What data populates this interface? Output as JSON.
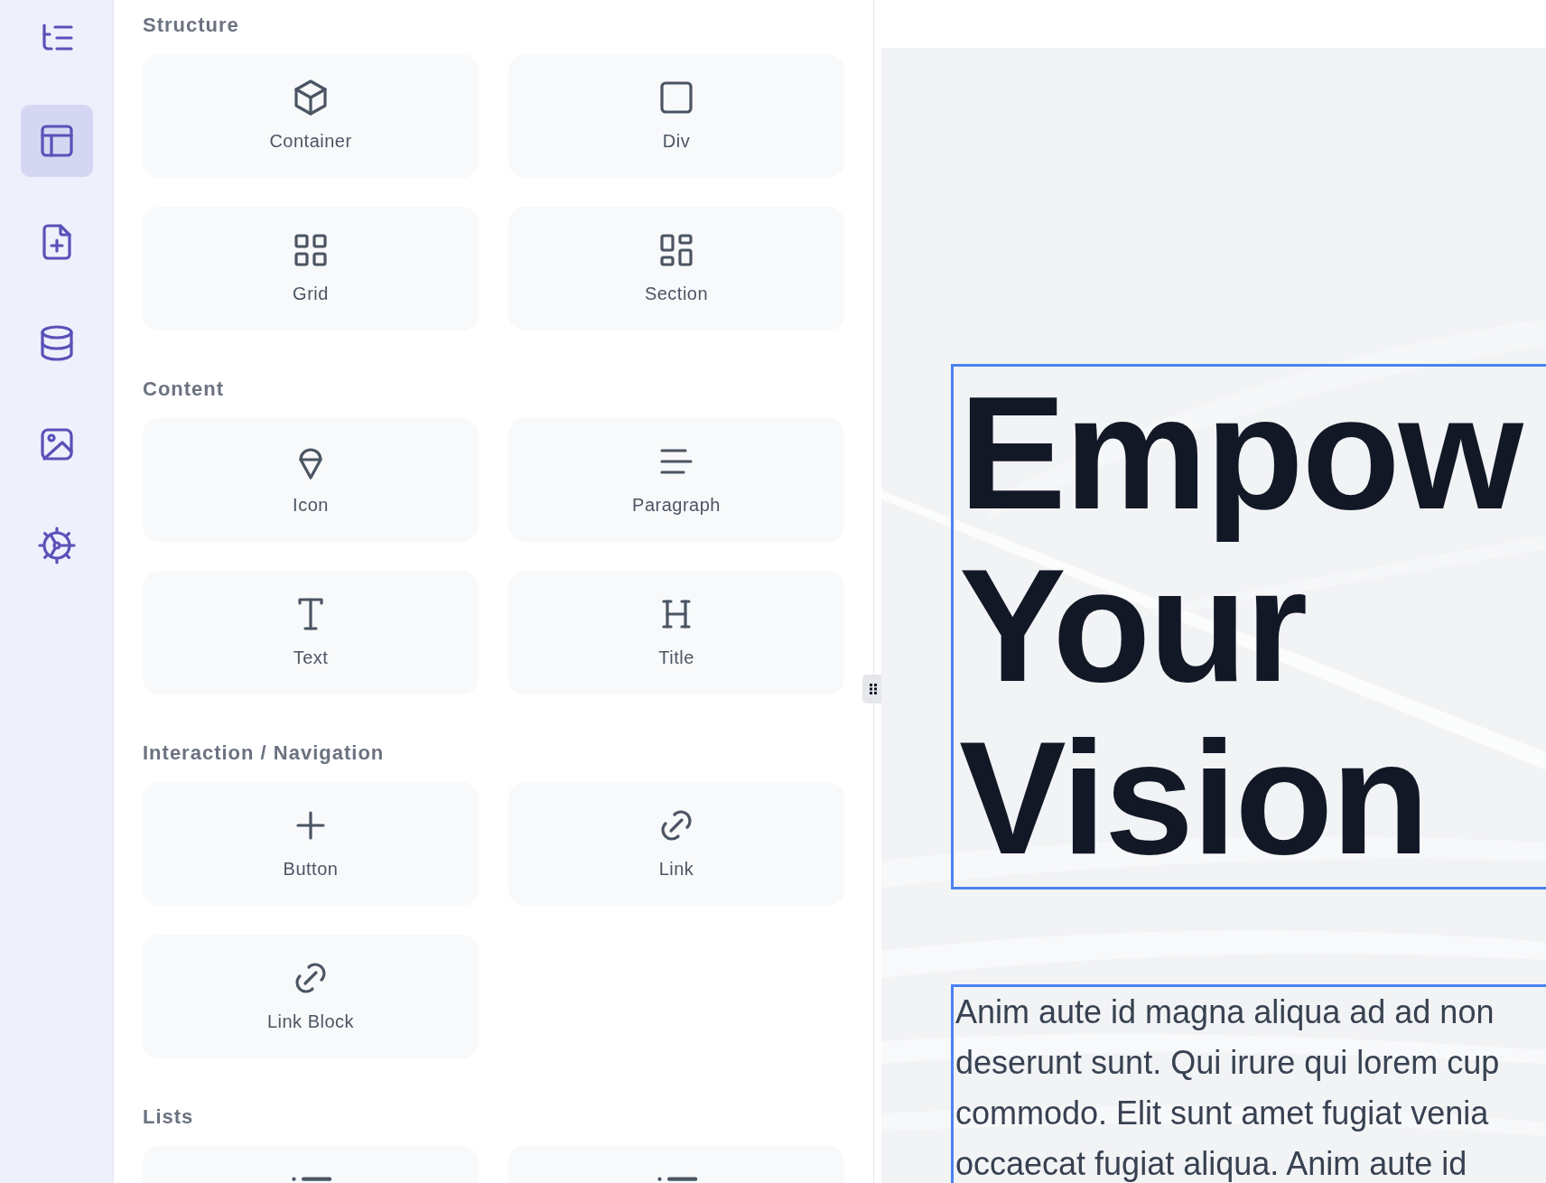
{
  "rail": [
    {
      "kind": "outline",
      "selected": false
    },
    {
      "kind": "layout",
      "selected": true
    },
    {
      "kind": "new-page",
      "selected": false
    },
    {
      "kind": "data",
      "selected": false
    },
    {
      "kind": "media",
      "selected": false
    },
    {
      "kind": "settings",
      "selected": false
    }
  ],
  "panel": {
    "sections": [
      {
        "title": "Structure",
        "blocks": [
          {
            "kind": "container",
            "label": "Container"
          },
          {
            "kind": "div",
            "label": "Div"
          },
          {
            "kind": "grid",
            "label": "Grid"
          },
          {
            "kind": "section",
            "label": "Section"
          }
        ]
      },
      {
        "title": "Content",
        "blocks": [
          {
            "kind": "icon",
            "label": "Icon"
          },
          {
            "kind": "paragraph",
            "label": "Paragraph"
          },
          {
            "kind": "text",
            "label": "Text"
          },
          {
            "kind": "title",
            "label": "Title"
          }
        ]
      },
      {
        "title": "Interaction / Navigation",
        "blocks": [
          {
            "kind": "button",
            "label": "Button"
          },
          {
            "kind": "link",
            "label": "Link"
          },
          {
            "kind": "link",
            "label": "Link Block"
          }
        ]
      },
      {
        "title": "Lists",
        "blocks": [
          {
            "kind": "list"
          },
          {
            "kind": "list"
          }
        ]
      }
    ]
  },
  "canvas": {
    "heading": "Empow\nYour\nVision",
    "paragraph": "Anim aute id magna aliqua ad ad non\ndeserunt sunt. Qui irure qui lorem cup\ncommodo. Elit sunt amet fugiat venia\noccaecat fugiat aliqua. Anim aute id"
  }
}
